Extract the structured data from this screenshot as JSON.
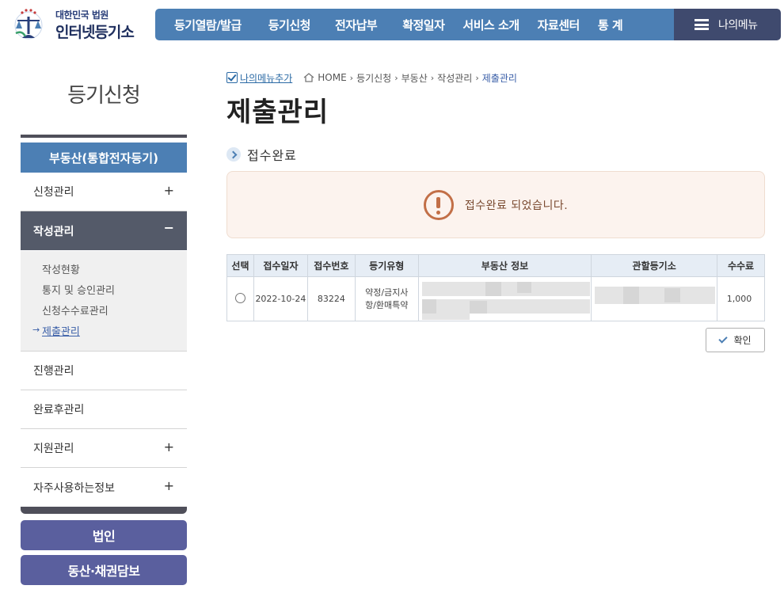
{
  "header": {
    "logo_sub": "대한민국 법원",
    "logo_main": "인터넷등기소",
    "nav": [
      "등기열람/발급",
      "등기신청",
      "전자납부",
      "확정일자",
      "서비스 소개",
      "자료센터",
      "통 계"
    ],
    "mymenu_label": "나의메뉴"
  },
  "sidebar": {
    "title": "등기신청",
    "category": "부동산(통합전자등기)",
    "items": [
      {
        "label": "신청관리",
        "toggle": "+"
      },
      {
        "label": "작성관리",
        "toggle": "−"
      },
      {
        "label": "진행관리",
        "toggle": ""
      },
      {
        "label": "완료후관리",
        "toggle": ""
      },
      {
        "label": "지원관리",
        "toggle": "+"
      },
      {
        "label": "자주사용하는정보",
        "toggle": "+"
      }
    ],
    "subitems": [
      "작성현황",
      "통지 및 승인관리",
      "신청수수료관리",
      "제출관리"
    ],
    "current_arrow": "→",
    "buttons": [
      "법인",
      "동산·채권담보"
    ]
  },
  "breadcrumb": {
    "add_mymenu": "나의메뉴추가",
    "items": [
      "HOME",
      "등기신청",
      "부동산",
      "작성관리",
      "제출관리"
    ]
  },
  "page_title": "제출관리",
  "section_title": "접수완료",
  "notice": "접수완료 되었습니다.",
  "table": {
    "headers": [
      "선택",
      "접수일자",
      "접수번호",
      "등기유형",
      "부동산 정보",
      "관할등기소",
      "수수료"
    ],
    "row": {
      "date": "2022-10-24",
      "number": "83224",
      "type": "약정/금지사항/환매특약",
      "fee": "1,000"
    }
  },
  "confirm_label": "확인",
  "colors": {
    "nav": "#4c7fb4",
    "mymenu": "#3f4a6e",
    "active": "#545a69",
    "bottom_buttons": "#5a5f9e",
    "warning": "#c26f47"
  }
}
